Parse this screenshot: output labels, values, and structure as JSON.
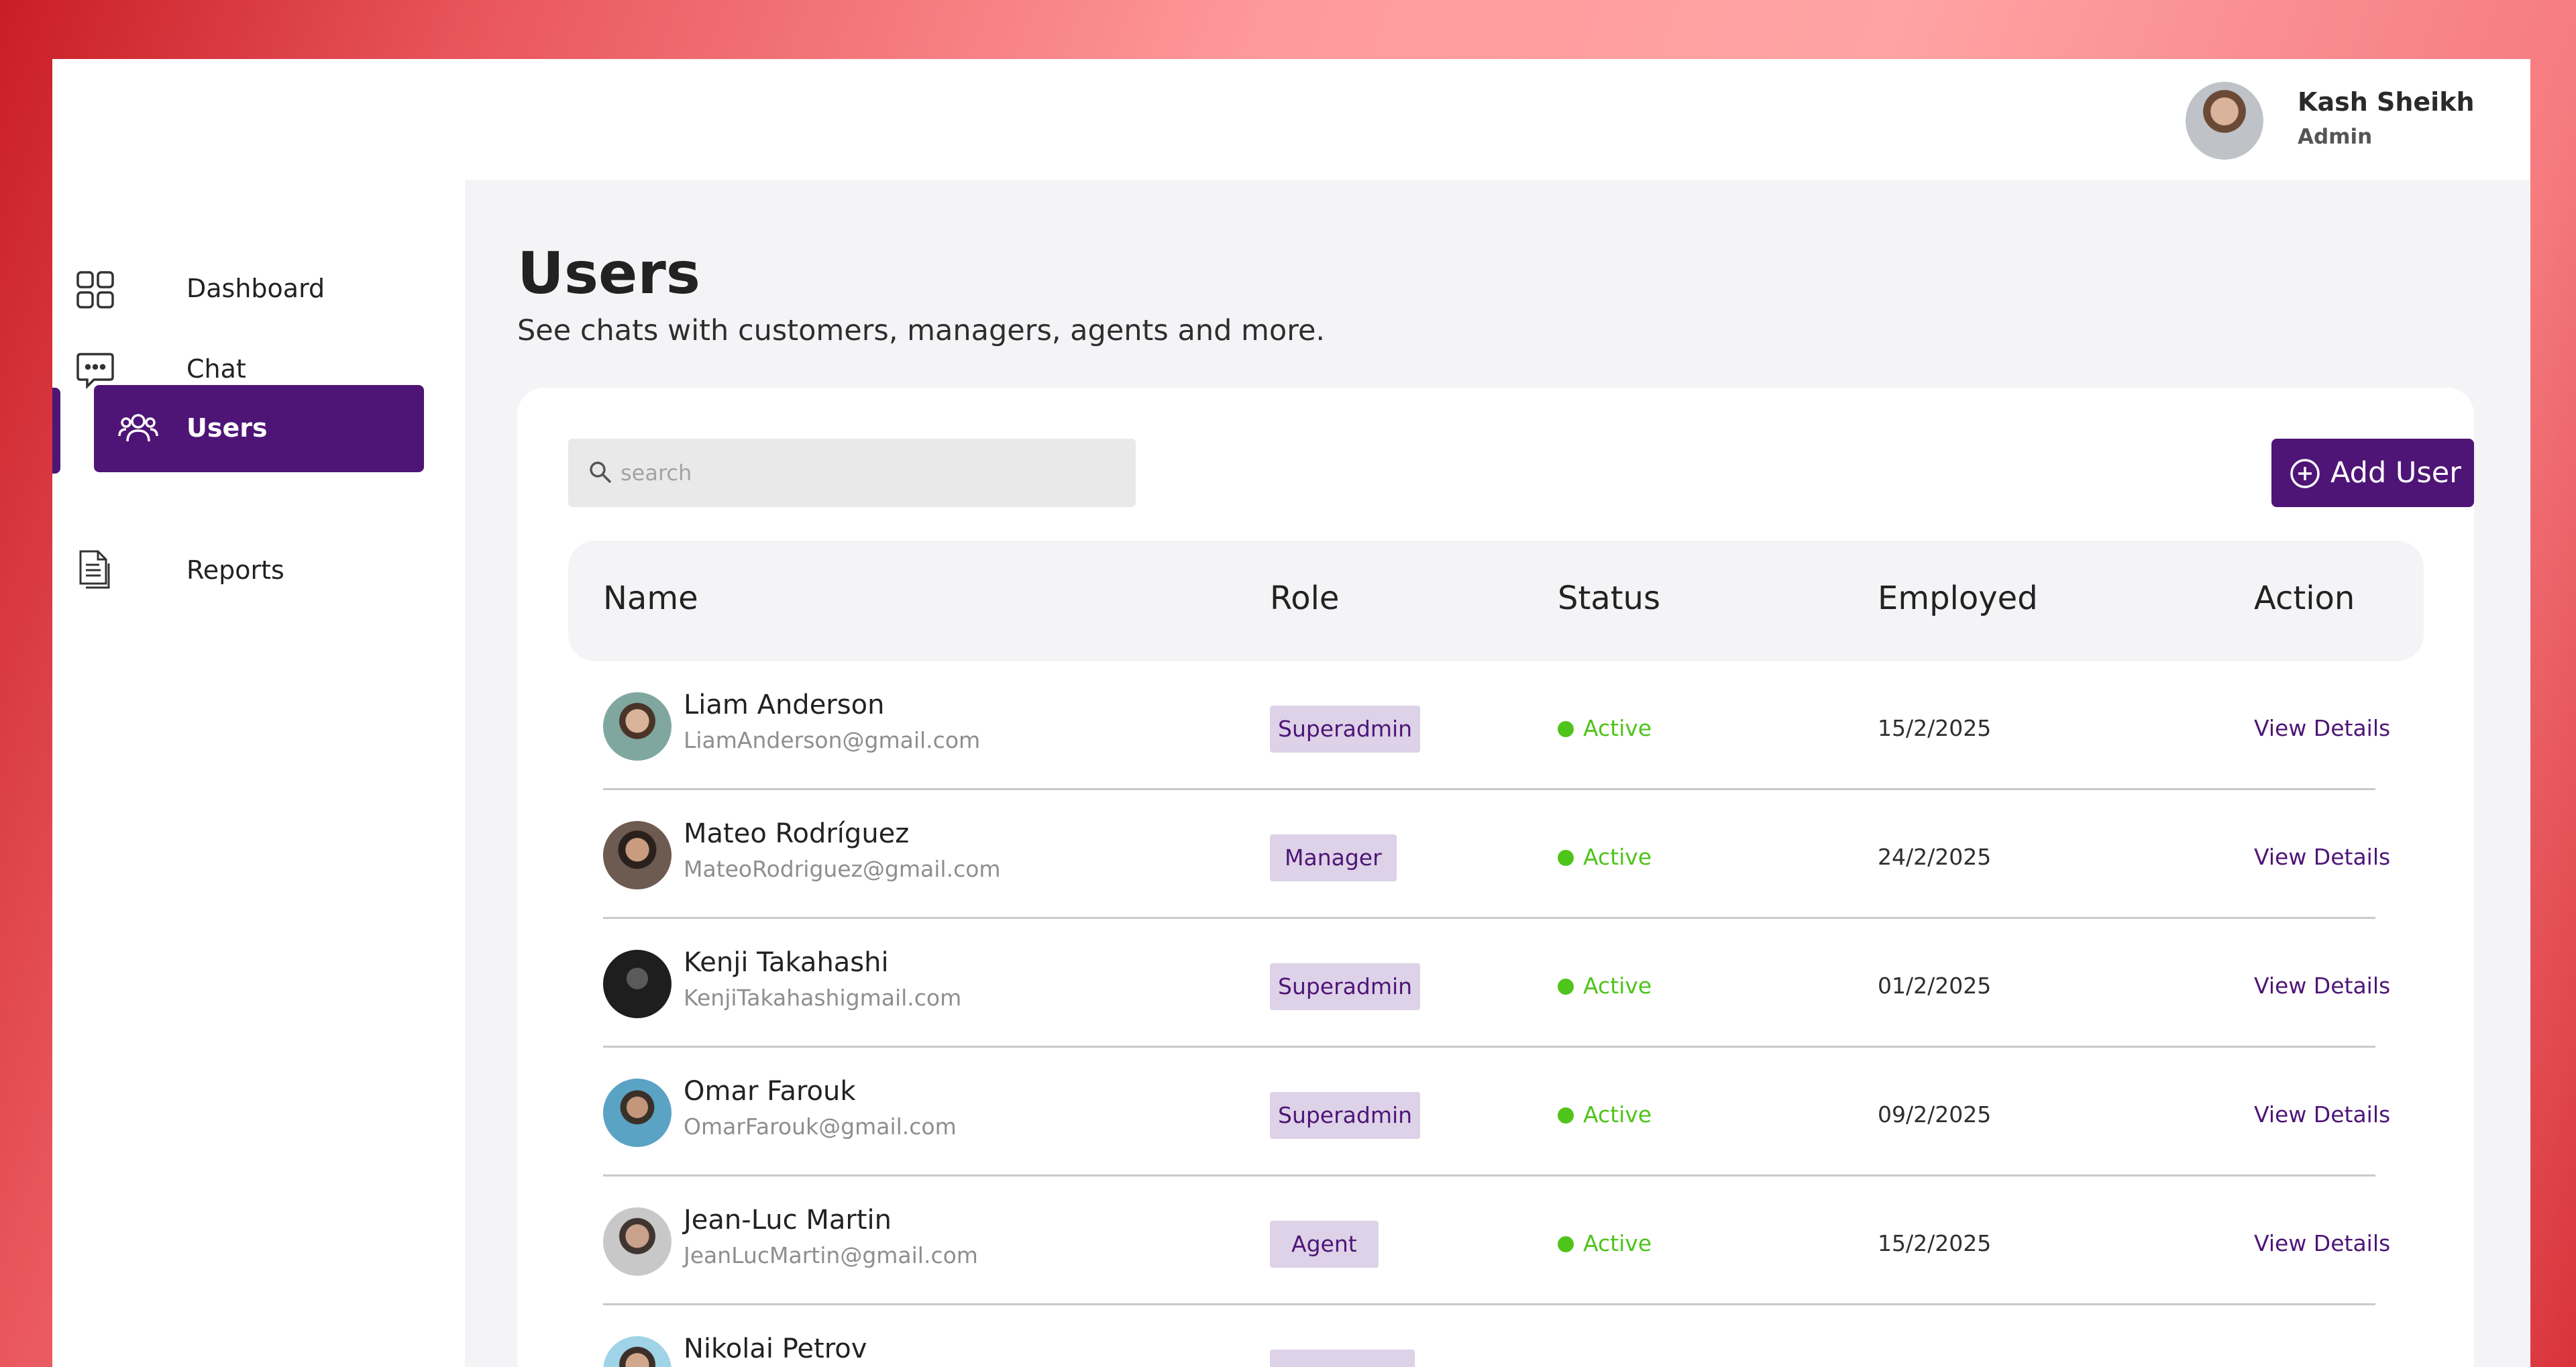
{
  "header": {
    "user_name": "Kash Sheikh",
    "user_role": "Admin"
  },
  "sidebar": {
    "items": [
      {
        "label": "Dashboard",
        "icon": "grid-icon",
        "active": false
      },
      {
        "label": "Chat",
        "icon": "chat-bubble-icon",
        "active": false
      },
      {
        "label": "Users",
        "icon": "users-icon",
        "active": true
      },
      {
        "label": "Reports",
        "icon": "document-icon",
        "active": false
      }
    ]
  },
  "main": {
    "title": "Users",
    "subtitle": "See chats with customers, managers, agents and more.",
    "search": {
      "placeholder": "search",
      "value": ""
    },
    "add_user_label": "Add User",
    "table": {
      "columns": [
        "Name",
        "Role",
        "Status",
        "Employed",
        "Action"
      ],
      "rows": [
        {
          "name": "Liam Anderson",
          "email": "LiamAnderson@gmail.com",
          "role": "Superadmin",
          "status": "Active",
          "employed": "15/2/2025",
          "action": "View Details"
        },
        {
          "name": "Mateo Rodríguez",
          "email": "MateoRodriguez@gmail.com",
          "role": "Manager",
          "status": "Active",
          "employed": "24/2/2025",
          "action": "View Details"
        },
        {
          "name": "Kenji Takahashi",
          "email": "KenjiTakahashigmail.com",
          "role": "Superadmin",
          "status": "Active",
          "employed": "01/2/2025",
          "action": "View Details"
        },
        {
          "name": "Omar Farouk",
          "email": "OmarFarouk@gmail.com",
          "role": "Superadmin",
          "status": "Active",
          "employed": "09/2/2025",
          "action": "View Details"
        },
        {
          "name": "Jean-Luc Martin",
          "email": "JeanLucMartin@gmail.com",
          "role": "Agent",
          "status": "Active",
          "employed": "15/2/2025",
          "action": "View Details"
        },
        {
          "name": "Nikolai Petrov",
          "email": "",
          "role": "",
          "status": "",
          "employed": "",
          "action": ""
        }
      ]
    }
  },
  "colors": {
    "brand_purple": "#4e1576",
    "status_active": "#4fc41a",
    "role_badge_bg": "#ddd2e8",
    "page_bg": "#f4f4f7"
  }
}
